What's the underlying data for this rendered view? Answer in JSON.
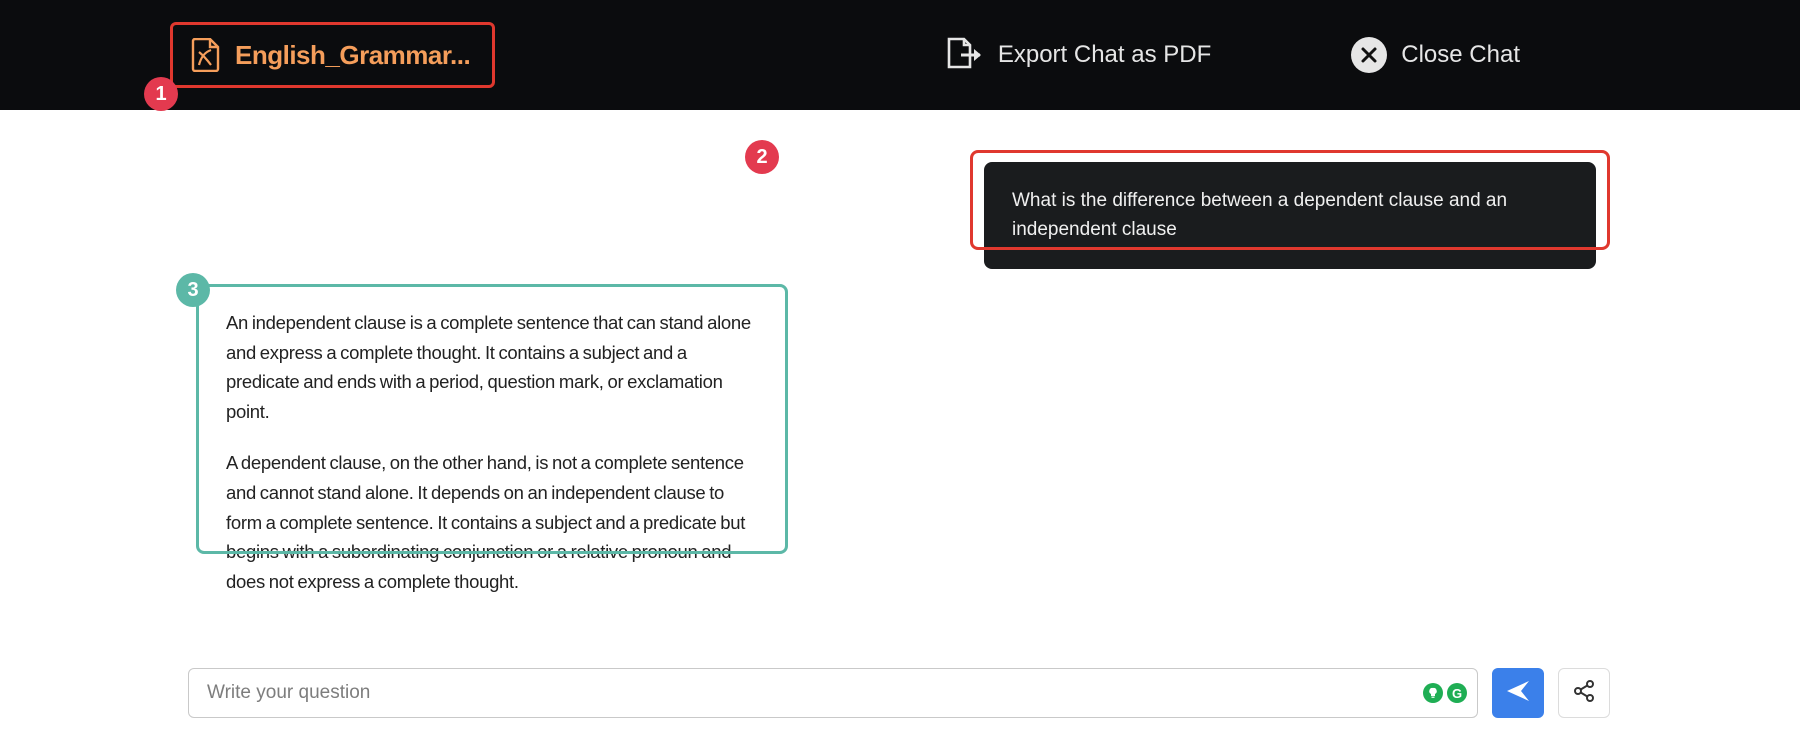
{
  "header": {
    "file_label": "English_Grammar...",
    "export_label": "Export Chat as PDF",
    "close_label": "Close Chat"
  },
  "badges": {
    "one": "1",
    "two": "2",
    "three": "3"
  },
  "chat": {
    "user_message": "What is the difference between a dependent clause and an independent clause",
    "assistant_p1": "An independent clause is a complete sentence that can stand alone and express a complete thought. It contains a subject and a predicate and ends with a period, question mark, or exclamation point.",
    "assistant_p2": "A dependent clause, on the other hand, is not a complete sentence and cannot stand alone. It depends on an independent clause to form a complete sentence. It contains a subject and a predicate but begins with a subordinating conjunction or a relative pronoun and does not express a complete thought."
  },
  "input": {
    "placeholder": "Write your question",
    "grammarly_letter": "G"
  },
  "icons": {
    "pdf": "pdf-file-icon",
    "export": "export-icon",
    "close": "close-icon",
    "send": "send-icon",
    "share": "share-icon",
    "bulb": "lightbulb-icon"
  }
}
